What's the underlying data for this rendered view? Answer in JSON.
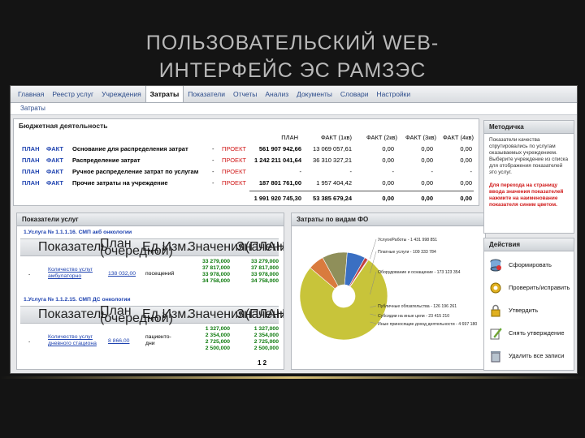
{
  "slide": {
    "title_line1": "ПОЛЬЗОВАТЕЛЬСКИЙ WEB-",
    "title_line2": "ИНТЕРФЕЙС ЭС РАМЗЭС"
  },
  "nav": [
    "Главная",
    "Реестр услуг",
    "Учреждения",
    "Затраты",
    "Показатели",
    "Отчеты",
    "Анализ",
    "Документы",
    "Словари",
    "Настройки"
  ],
  "subnav": "Затраты",
  "budget": {
    "title": "Бюджетная деятельность",
    "headers": [
      "ПЛАН",
      "ФАКТ (1кв)",
      "ФАКТ (2кв)",
      "ФАКТ (3кв)",
      "ФАКТ (4кв)"
    ],
    "rows": [
      {
        "plan": "ПЛАН",
        "fact": "ФАКТ",
        "name": "Основание для распределения затрат",
        "dash": "-",
        "status": "ПРОЕКТ",
        "v": [
          "561 907 942,66",
          "13 069 057,61",
          "0,00",
          "0,00",
          "0,00"
        ]
      },
      {
        "plan": "ПЛАН",
        "fact": "ФАКТ",
        "name": "Распределение затрат",
        "dash": "-",
        "status": "ПРОЕКТ",
        "v": [
          "1 242 211 041,64",
          "36 310 327,21",
          "0,00",
          "0,00",
          "0,00"
        ]
      },
      {
        "plan": "ПЛАН",
        "fact": "ФАКТ",
        "name": "Ручное распределение затрат по услугам",
        "dash": "-",
        "status": "ПРОЕКТ",
        "v": [
          "-",
          "-",
          "-",
          "-",
          "-"
        ]
      },
      {
        "plan": "ПЛАН",
        "fact": "ФАКТ",
        "name": "Прочие затраты на учреждение",
        "dash": "-",
        "status": "ПРОЕКТ",
        "v": [
          "187 801 761,00",
          "1 957 404,42",
          "0,00",
          "0,00",
          "0,00"
        ]
      }
    ],
    "totals": [
      "1 991 920 745,30",
      "53 385 679,24",
      "0,00",
      "0,00",
      "0,00"
    ]
  },
  "services": {
    "title": "Показатели услуг",
    "groups": [
      {
        "heading": "1.Услуга № 1.1.1.16. СМП акб онкологии",
        "cols": [
          "Показатель",
          "План (очередной)",
          "Ед.Изм.",
          "Значения(ПЛАН)",
          "Значения(ФАКТ)"
        ],
        "dash": "-",
        "item": "Количество услуг амбулаторно",
        "plan": "138 032,00",
        "unit": "посещений",
        "plan_vals": [
          "33 279,000",
          "37 817,000",
          "33 978,000",
          "34 758,000"
        ],
        "fact_vals": [
          "33 279,000",
          "37 817,000",
          "33 978,000",
          "34 758,000"
        ]
      },
      {
        "heading": "1.Услуга № 1.1.2.15. СМП ДС онкологии",
        "cols": [
          "Показатель",
          "План (очередной)",
          "Ед.Изм.",
          "Значения(ПЛАН)",
          "Значения(ФАКТ)"
        ],
        "dash": "-",
        "item": "Количество услуг дневного стациона",
        "plan": "8 866,00",
        "unit": "пациенто-дни",
        "plan_vals": [
          "1 327,000",
          "2 354,000",
          "2 725,000",
          "2 500,000"
        ],
        "fact_vals": [
          "1 327,000",
          "2 354,000",
          "2 725,000",
          "2 500,000"
        ]
      }
    ],
    "pager": "1 2"
  },
  "costs": {
    "title": "Затраты по видам ФО",
    "legend": [
      "Услуги/Работы - 1 431 998 851",
      "Платные услуги - 109 333 784",
      "Оборудование и оснащение - 173 123 354",
      "Публичные обязательства - 126 196 261",
      "Субсидии на иные цели - 23 415 210",
      "Иные приносящие доход деятельности - 4 697 180"
    ],
    "chart_data": {
      "type": "pie",
      "labels": [
        "Услуги/Работы",
        "Платные услуги",
        "Оборудование и оснащение",
        "Публичные обязательства",
        "Субсидии на иные цели",
        "Иные приносящие доход деятельности"
      ],
      "values": [
        1431998851,
        109333784,
        173123354,
        126196261,
        23415210,
        4697180
      ],
      "colors": [
        "#c8c43a",
        "#d97b3e",
        "#8f8f5a",
        "#3a6fc2",
        "#c24040",
        "#7a4aa8"
      ]
    }
  },
  "method": {
    "title": "Методичка",
    "text": "Показатели качества спрутировались по услугам оказываемых учреждением. Выберите учреждение из списка для отображения показателей это услуг.",
    "note": "Для перехода на страницу ввода значения показателей нажмите на наименование показателя синим цветом."
  },
  "actions": {
    "title": "Действия",
    "items": [
      "Сформировать",
      "Проверить/исправить",
      "Утвердить",
      "Снять утверждение",
      "Удалить все записи"
    ]
  }
}
